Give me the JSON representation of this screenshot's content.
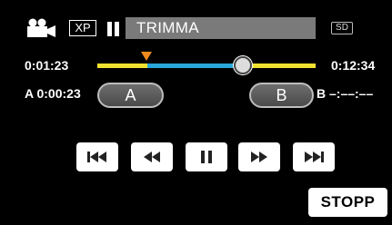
{
  "header": {
    "mode_icon": "video-camera-icon",
    "quality": "XP",
    "state_icon": "pause-icon",
    "title": "TRIMMA",
    "media": "SD"
  },
  "timeline": {
    "current_time": "0:01:23",
    "total_time": "0:12:34",
    "playhead_position": 0.65,
    "marker_a_position": 0.2,
    "colors": {
      "track": "#f2e230",
      "selection": "#29a7d8",
      "marker": "#f08a1e"
    }
  },
  "trim": {
    "a_time_label": "A 0:00:23",
    "a_button": "A",
    "b_button": "B",
    "b_time_label": "B  –:––:––"
  },
  "transport": [
    {
      "icon": "skip-back-icon"
    },
    {
      "icon": "rewind-icon"
    },
    {
      "icon": "pause-icon"
    },
    {
      "icon": "fast-forward-icon"
    },
    {
      "icon": "skip-forward-icon"
    }
  ],
  "footer": {
    "stop_label": "STOPP"
  }
}
